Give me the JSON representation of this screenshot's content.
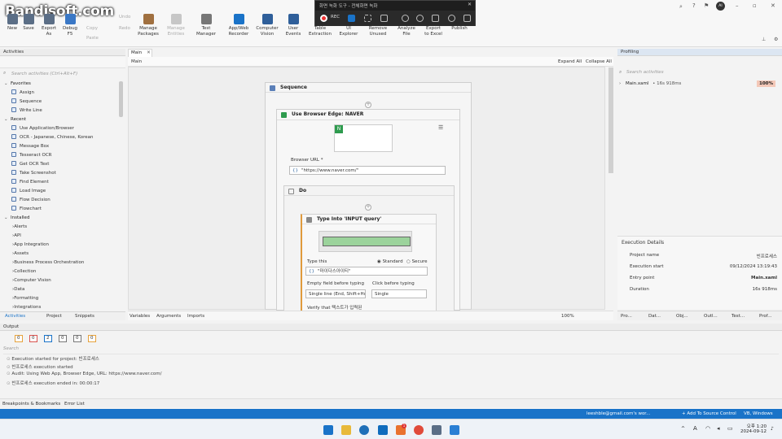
{
  "watermark": "Bandisoft.com",
  "recorder": {
    "title": "화면 녹화 도구 - 전체화면 녹화",
    "rec_label": "REC"
  },
  "ribbon": {
    "new": "New",
    "save": "Save",
    "export": "Export\nAs",
    "debug": "Debug\nF5",
    "manage_packages": "Manage\nPackages",
    "manage_entities": "Manage\nEntities",
    "test_manager": "Test\nManager",
    "app_web_recorder": "App/Web\nRecorder",
    "computer_vision": "Computer\nVision",
    "user_events": "User\nEvents",
    "table_extraction": "Table\nExtraction",
    "ui_explorer": "UI\nExplorer",
    "remove_unused": "Remove\nUnused",
    "analyze_file": "Analyze\nFile",
    "export_excel": "Export\nto Excel",
    "publish": "Publish",
    "copy": "Copy",
    "paste": "Paste",
    "undo": "Undo",
    "redo": "Redo",
    "user_avatar": "AI"
  },
  "activities": {
    "title": "Activities",
    "search_placeholder": "Search activities (Ctrl+Alt+F)",
    "favorites_label": "Favorites",
    "favorites": [
      "Assign",
      "Sequence",
      "Write Line"
    ],
    "recent_label": "Recent",
    "recent": [
      "Use Application/Browser",
      "OCR - Japanese, Chinese, Korean",
      "Message Box",
      "Tesseract OCR",
      "Get OCR Text",
      "Take Screenshot",
      "Find Element",
      "Load Image",
      "Flow Decision",
      "Flowchart"
    ],
    "installed_label": "Installed",
    "installed": [
      "Alerts",
      "API",
      "App Integration",
      "Assets",
      "Business Process Orchestration",
      "Collection",
      "Computer Vision",
      "Data",
      "Formatting",
      "Integrations"
    ],
    "bottom_tabs": [
      "Activities",
      "Project",
      "Snippets"
    ]
  },
  "designer": {
    "tab": "Main",
    "breadcrumb": "Main",
    "expand_all": "Expand All",
    "collapse_all": "Collapse All",
    "sequence": "Sequence",
    "browser_title": "Use Browser Edge: NAVER",
    "browser_url_label": "Browser URL *",
    "browser_url": "\"https://www.naver.com/\"",
    "do": "Do",
    "type_title": "Type Into 'INPUT query'",
    "type_this_label": "Type this",
    "standard": "Standard",
    "secure": "Secure",
    "type_value": "\"마이다스아이티\"",
    "empty_field_label": "Empty field before typing",
    "empty_field_value": "Single line (End, Shift+Ho",
    "click_before_label": "Click before typing",
    "click_before_value": "Single",
    "verify_partial": "Verify that 텍스트가 입력된",
    "bottom_tabs": [
      "Variables",
      "Arguments",
      "Imports"
    ],
    "zoom": "100%"
  },
  "profiling": {
    "title": "Profiling",
    "search_placeholder": "Search activities",
    "row_name": "Main.xaml",
    "row_time": "• 16s 918ms",
    "row_percent": "100%"
  },
  "execution": {
    "title": "Execution Details",
    "rows": [
      {
        "label": "Project name",
        "value": "빈프로세스"
      },
      {
        "label": "Execution start",
        "value": "09/12/2024 13:19:43"
      },
      {
        "label": "Entry point",
        "value": "Main.xaml"
      },
      {
        "label": "Duration",
        "value": "16s 918ms"
      }
    ]
  },
  "right_tabs": [
    "Pro...",
    "Dat...",
    "Obj...",
    "Outl...",
    "Test...",
    "Prof..."
  ],
  "output": {
    "title": "Output",
    "counts": [
      "0",
      "0",
      "2",
      "0",
      "0",
      "0"
    ],
    "search_placeholder": "Search",
    "lines": [
      "Execution started for project: 빈프로세스",
      "빈프로세스 execution started",
      "Audit: Using Web App, Browser Edge, URL: https://www.naver.com/",
      "빈프로세스 execution ended in: 00:00:17"
    ]
  },
  "footer_tabs": [
    "Breakpoints & Bookmarks",
    "Error List"
  ],
  "status": {
    "account": "leeshble@gmail.com's wor...",
    "source_control": "+ Add To Source Control",
    "language": "VB, Windows"
  },
  "taskbar": {
    "time": "오후 1:20",
    "date": "2024-09-12",
    "lang": "A",
    "badge": "1"
  },
  "colors": {
    "accent": "#1a73c8",
    "warning": "#e6a23c",
    "green": "#2e9b4e"
  }
}
